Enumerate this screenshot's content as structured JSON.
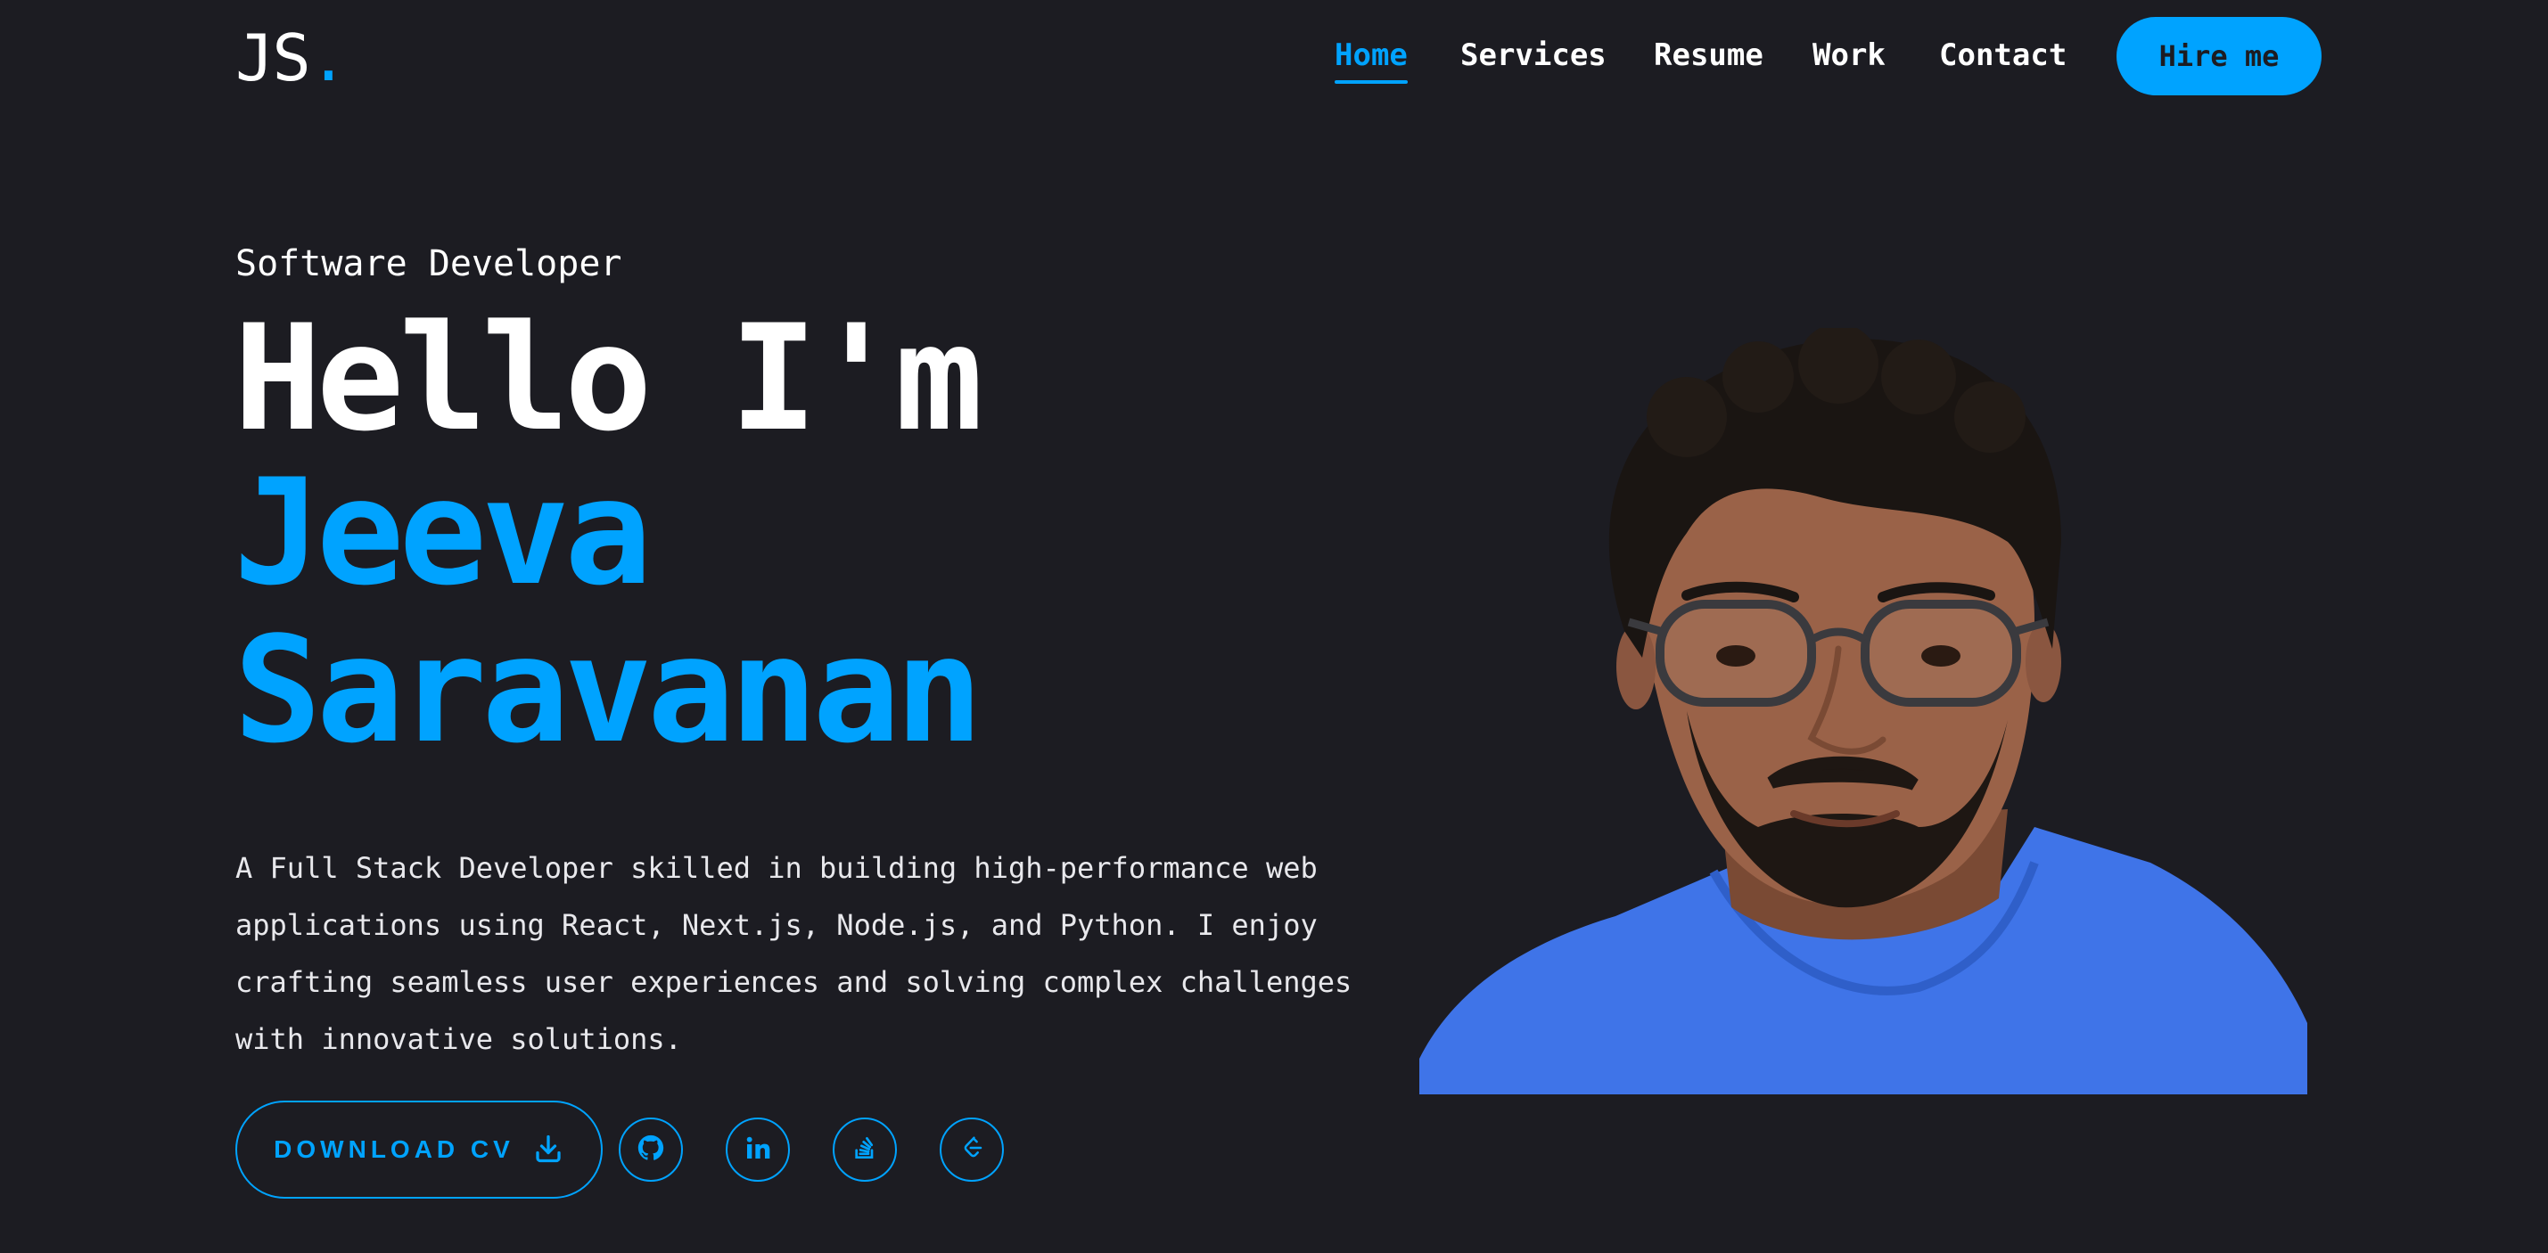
{
  "header": {
    "logo_text": "JS",
    "logo_dot": ".",
    "nav": [
      {
        "label": "Home",
        "active": true
      },
      {
        "label": "Services",
        "active": false
      },
      {
        "label": "Resume",
        "active": false
      },
      {
        "label": "Work",
        "active": false
      },
      {
        "label": "Contact",
        "active": false
      }
    ],
    "hire_label": "Hire me"
  },
  "hero": {
    "subtitle": "Software Developer",
    "greeting": "Hello I'm",
    "first_name": "Jeeva",
    "last_name": "Saravanan",
    "description": "A Full Stack Developer skilled in building high-performance web applications using React, Next.js, Node.js, and Python. I enjoy crafting seamless user experiences and solving complex challenges with innovative solutions.",
    "download_cv_label": "DOWNLOAD CV",
    "socials": [
      {
        "icon": "github-icon"
      },
      {
        "icon": "linkedin-icon"
      },
      {
        "icon": "stackoverflow-icon"
      },
      {
        "icon": "leetcode-icon"
      }
    ]
  },
  "colors": {
    "background": "#1c1c22",
    "accent": "#00a3ff",
    "text": "#ffffff"
  }
}
